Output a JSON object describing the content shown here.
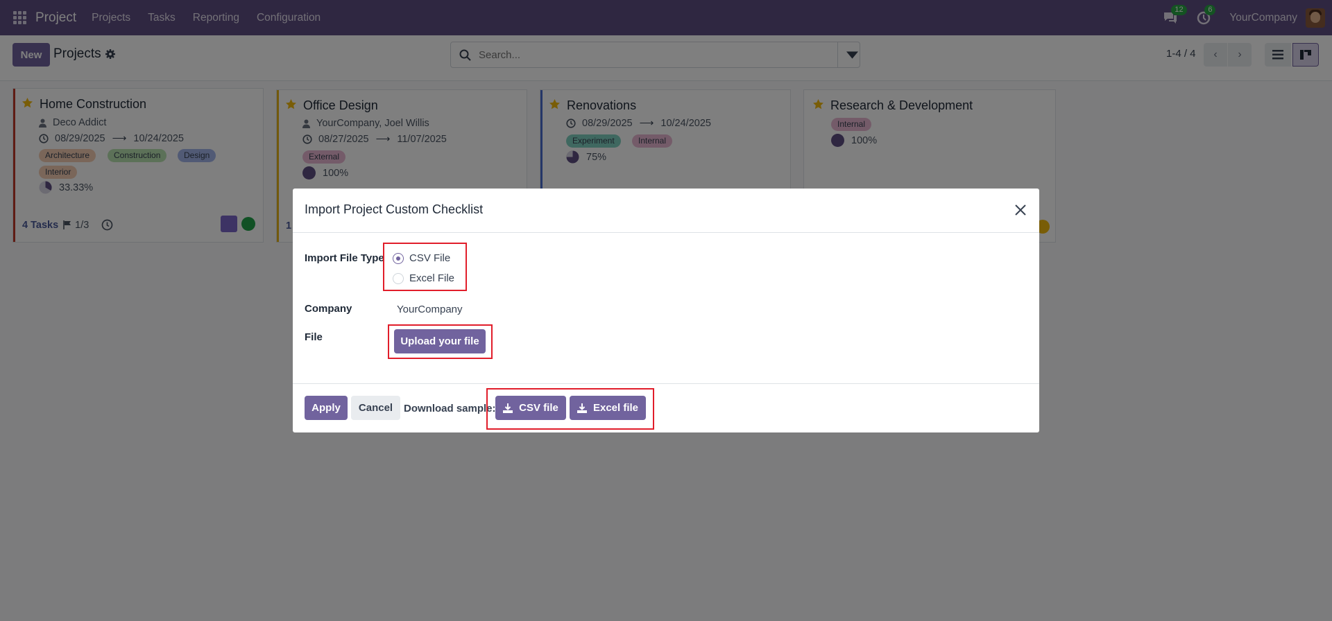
{
  "navbar": {
    "app_name": "Project",
    "menu": [
      "Projects",
      "Tasks",
      "Reporting",
      "Configuration"
    ],
    "messages_count": "12",
    "activities_count": "6",
    "company": "YourCompany"
  },
  "control": {
    "new_label": "New",
    "title": "Projects",
    "search_placeholder": "Search...",
    "pager": "1-4 / 4"
  },
  "cards": [
    {
      "title": "Home Construction",
      "customer": "Deco Addict",
      "start": "08/29/2025",
      "end": "10/24/2025",
      "tags": [
        "Architecture",
        "Construction",
        "Design",
        "Interior"
      ],
      "progress": "33.33%",
      "tasks": "4 Tasks",
      "milestones": "1/3"
    },
    {
      "title": "Office Design",
      "customer": "YourCompany, Joel Willis",
      "start": "08/27/2025",
      "end": "11/07/2025",
      "tags": [
        "External"
      ],
      "progress": "100%",
      "tasks_partial": "1"
    },
    {
      "title": "Renovations",
      "start": "08/29/2025",
      "end": "10/24/2025",
      "tags": [
        "Experiment",
        "Internal"
      ],
      "progress": "75%"
    },
    {
      "title": "Research & Development",
      "tags": [
        "Internal"
      ],
      "progress": "100%"
    }
  ],
  "modal": {
    "title": "Import Project Custom Checklist",
    "file_type_label": "Import File Type",
    "options": [
      "CSV File",
      "Excel File"
    ],
    "selected_option": "CSV File",
    "company_label": "Company",
    "company_value": "YourCompany",
    "file_label": "File",
    "upload_label": "Upload your file",
    "apply_label": "Apply",
    "cancel_label": "Cancel",
    "download_label": "Download sample:",
    "csv_label": "CSV file",
    "excel_label": "Excel file"
  },
  "colors": {
    "navbar": "#5e4e82",
    "primary": "#71639e",
    "highlight": "#e11d2a"
  }
}
